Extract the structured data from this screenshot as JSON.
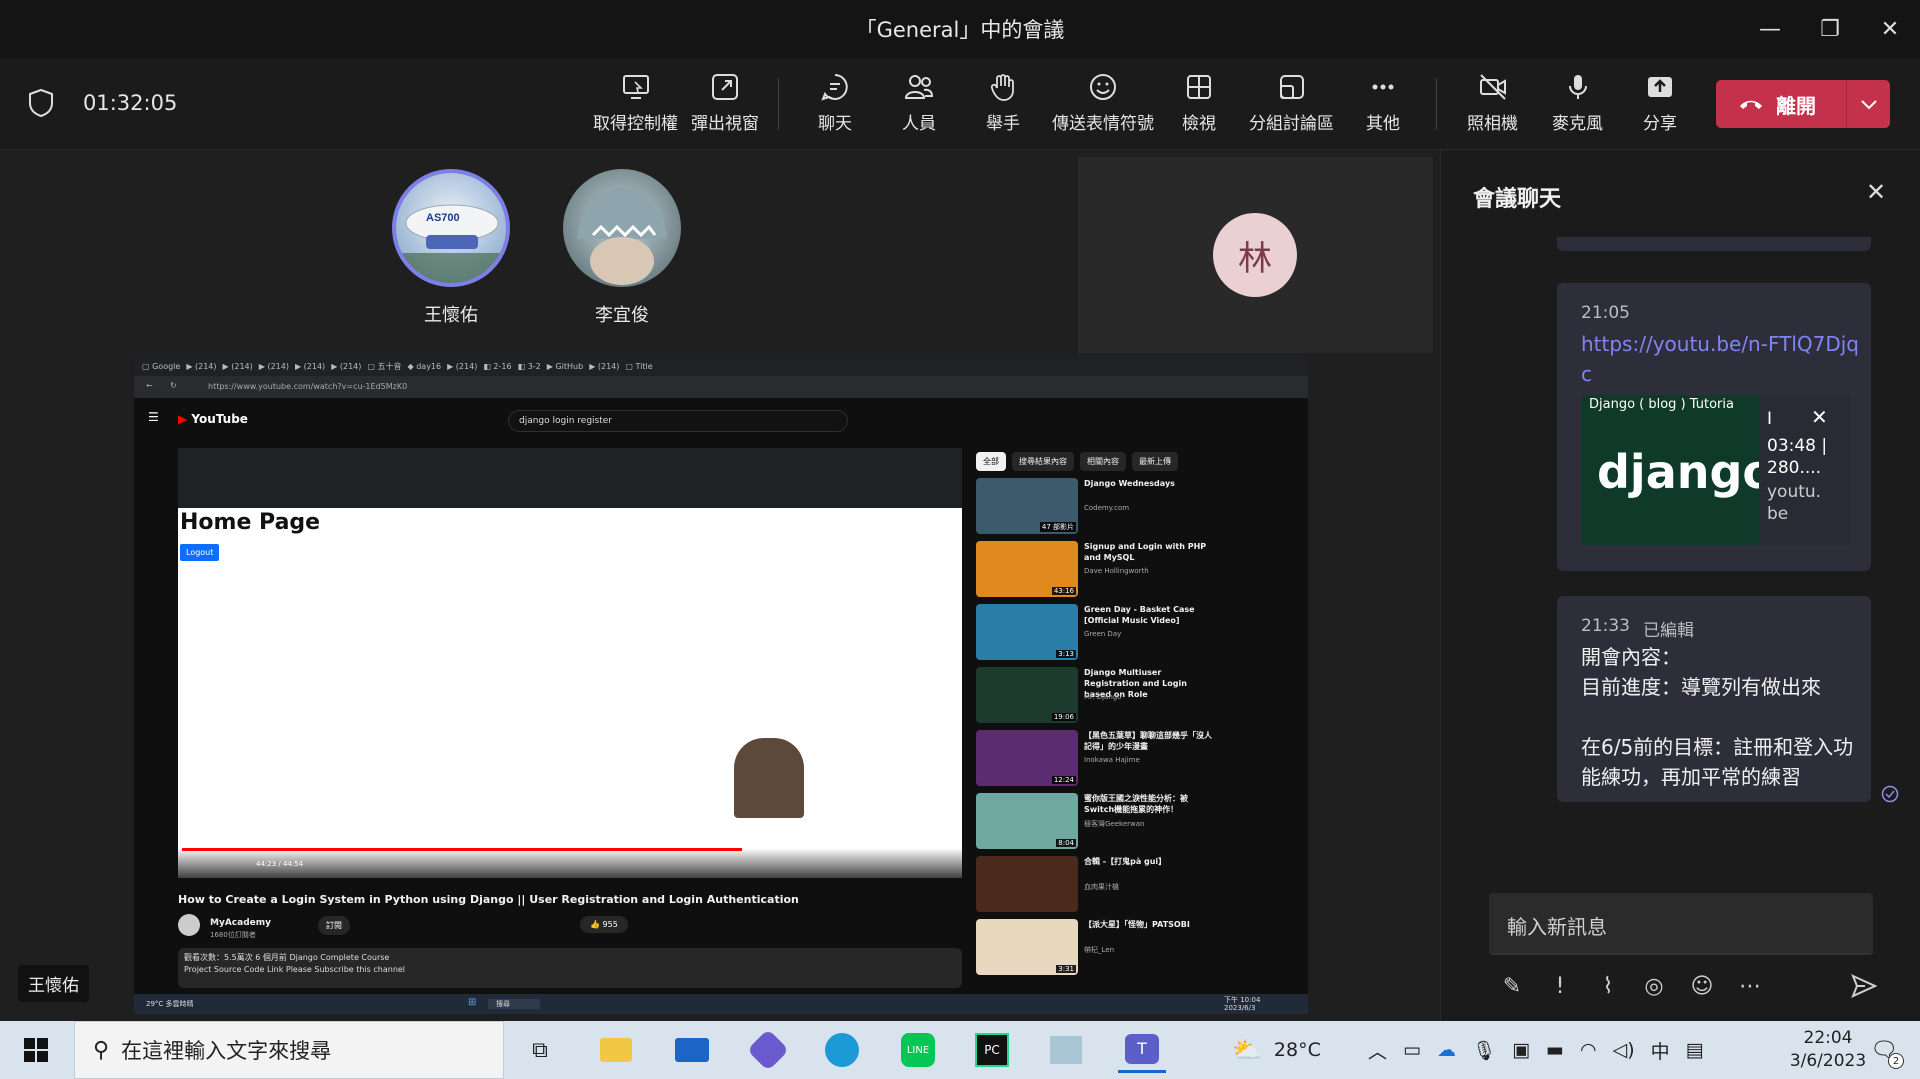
{
  "window": {
    "title": "「General」中的會議"
  },
  "toolbar": {
    "timer": "01:32:05",
    "buttons": [
      {
        "label": "取得控制權",
        "icon": "take-control-icon"
      },
      {
        "label": "彈出視窗",
        "icon": "pop-out-icon"
      },
      {
        "label": "聊天",
        "icon": "chat-icon"
      },
      {
        "label": "人員",
        "icon": "people-icon"
      },
      {
        "label": "舉手",
        "icon": "raise-hand-icon"
      },
      {
        "label": "傳送表情符號",
        "icon": "emoji-icon"
      },
      {
        "label": "檢視",
        "icon": "view-icon"
      },
      {
        "label": "分組討論區",
        "icon": "breakout-icon"
      },
      {
        "label": "其他",
        "icon": "more-icon"
      },
      {
        "label": "照相機",
        "icon": "camera-off-icon"
      },
      {
        "label": "麥克風",
        "icon": "microphone-icon"
      },
      {
        "label": "分享",
        "icon": "share-icon"
      }
    ],
    "leave_label": "離開"
  },
  "participants": [
    {
      "name": "王懷佑"
    },
    {
      "name": "李宜俊"
    }
  ],
  "tile_monogram": "林",
  "speaker_label": "王懷佑",
  "shared_screen": {
    "url": "https://www.youtube.com/watch?v=cu-1Ed5MzK0",
    "yt_logo": "YouTube",
    "search_query": "django login register",
    "page_heading": "Home Page",
    "logout_label": "Logout",
    "video_title": "How to Create a Login System in Python using Django || User Registration and Login Authentication",
    "channel": "MyAcademy",
    "subscribers": "1680位訂閱者",
    "subscribe_label": "訂閱",
    "likes": "955",
    "time": "44:23 / 44:54",
    "desc_line1": "觀看次數：5.5萬次 6 個月前  Django Complete Course",
    "desc_line2": "Project Source Code Link Please Subscribe this channel",
    "chips": [
      "全部",
      "搜尋結果內容",
      "相關內容",
      "最新上傳"
    ],
    "suggestions": [
      {
        "title": "Django Wednesdays",
        "channel": "Codemy.com",
        "duration": "47 部影片",
        "color": "#3d5a6c"
      },
      {
        "title": "Signup and Login with PHP and MySQL",
        "channel": "Dave Hollingworth",
        "duration": "43:16",
        "color": "#e08a1e"
      },
      {
        "title": "Green Day - Basket Case [Official Music Video]",
        "channel": "Green Day",
        "duration": "3:13",
        "color": "#2a7fa8"
      },
      {
        "title": "Django Multiuser Registration and Login based on Role",
        "channel": "Mr. Django",
        "duration": "19:06",
        "color": "#1c3b2e"
      },
      {
        "title": "【黑色五葉草】聊聊這部幾乎「沒人記得」的少年漫畫",
        "channel": "Inokawa Hajime",
        "duration": "12:24",
        "color": "#5b2c6f"
      },
      {
        "title": "蜜你版王國之淚性能分析：被Switch機能拖累的神作！",
        "channel": "極客灣Geekerwan",
        "duration": "8:04",
        "color": "#6fa8a0"
      },
      {
        "title": "合輯 -【打鬼pà gui】",
        "channel": "血肉果汁機",
        "duration": "",
        "color": "#4a2a1a"
      },
      {
        "title": "【派大星】「怪物」PATSOBI",
        "channel": "帶杞_Len",
        "duration": "3:31",
        "color": "#e8d8c0"
      }
    ],
    "os_search": "搜尋",
    "os_weather": "29°C 多雲時晴",
    "os_clock_time": "下午 10:04",
    "os_clock_date": "2023/6/3"
  },
  "chat": {
    "title": "會議聊天",
    "messages": [
      {
        "time": "21:05",
        "link": "https://youtu.be/n-FTlQ7Djqc",
        "preview_title": "Django ( blog ) Tutoria",
        "preview_info": "03:48 | 280....",
        "preview_domain": "youtu.be",
        "preview_brand": "django"
      },
      {
        "time": "21:33",
        "edited": "已編輯",
        "lines": [
          "開會內容：",
          "目前進度：導覽列有做出來",
          "",
          "在6/5前的目標：註冊和登入功能練功，再加平常的練習"
        ]
      }
    ],
    "compose_placeholder": "輸入新訊息"
  },
  "taskbar": {
    "search_placeholder": "在這裡輸入文字來搜尋",
    "weather": "28°C",
    "ime": "中",
    "time": "22:04",
    "date": "3/6/2023",
    "notifications": "2"
  },
  "colors": {
    "leave": "#c4314b",
    "link": "#7f85f5",
    "accent": "#6264a7"
  }
}
